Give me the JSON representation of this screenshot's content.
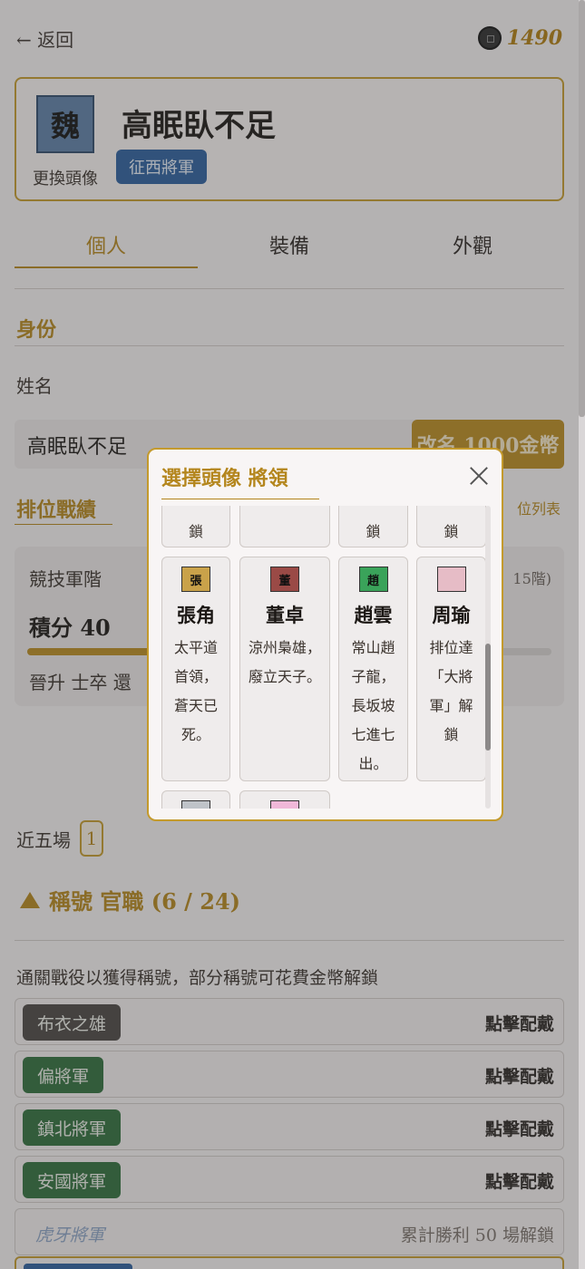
{
  "header": {
    "back_label": "← 返回",
    "coins": "1490"
  },
  "profile": {
    "avatar_char": "魏",
    "change_avatar": "更換頭像",
    "name": "高眠臥不足",
    "title_badge": "征西將軍"
  },
  "tabs": [
    "個人",
    "裝備",
    "外觀"
  ],
  "identity": {
    "heading": "身份",
    "name_label": "姓名",
    "name_value": "高眠臥不足",
    "rename_button": "改名 1000金幣"
  },
  "ranking": {
    "heading": "排位戰績",
    "peek_right": "位列表",
    "rank_title": "競技軍階",
    "rank_step": "15階)",
    "score": "積分 40",
    "progress": 0.25,
    "promote": "晉升 士卒 還"
  },
  "recent": {
    "label": "近五場",
    "chip": "1"
  },
  "titles": {
    "heading": "稱號 官職 (6 / 24)",
    "hint": "通關戰役以獲得稱號，部分稱號可花費金幣解鎖",
    "rows": [
      {
        "name": "布衣之雄",
        "color": "#4a4643",
        "action": "點擊配戴"
      },
      {
        "name": "偏將軍",
        "color": "#2e6e3b",
        "action": "點擊配戴"
      },
      {
        "name": "鎮北將軍",
        "color": "#2e6e3b",
        "action": "點擊配戴"
      },
      {
        "name": "安國將軍",
        "color": "#2e6e3b",
        "action": "點擊配戴"
      }
    ],
    "locked": {
      "name": "虎牙將軍",
      "condition": "累計勝利 50 場解鎖"
    }
  },
  "modal": {
    "title": "選擇頭像 將領",
    "top_row": [
      "鎖",
      "",
      "鎖",
      "鎖"
    ],
    "cards": [
      {
        "flag": "張",
        "flag_color": "#c9a24a",
        "name": "張角",
        "desc": "太平道首領，蒼天已死。"
      },
      {
        "flag": "董",
        "flag_color": "#9a4a46",
        "name": "董卓",
        "desc": "涼州梟雄，廢立天子。"
      },
      {
        "flag": "趙",
        "flag_color": "#3aa35a",
        "name": "趙雲",
        "desc": "常山趙子龍，長坂坡七進七出。"
      },
      {
        "flag": "",
        "flag_color": "#e6bcc6",
        "name": "周瑜",
        "desc": "排位達「大將軍」解鎖"
      }
    ],
    "bottom_flags": [
      "#bfc3c8",
      "#f0b8d8"
    ]
  }
}
